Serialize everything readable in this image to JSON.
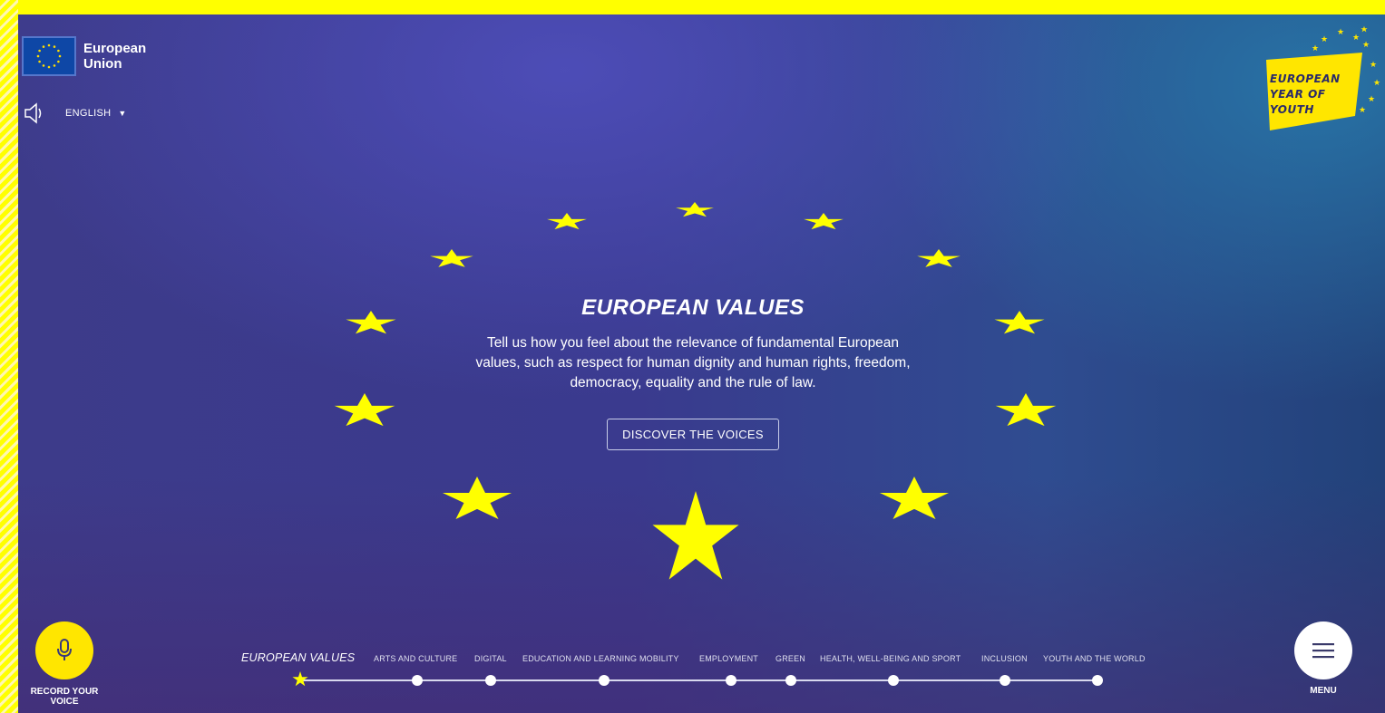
{
  "eu_logo": {
    "line1": "European",
    "line2": "Union"
  },
  "language": {
    "selected": "ENGLISH"
  },
  "eyoy_badge": {
    "line1": "EUROPEAN",
    "line2": "YEAR OF",
    "line3": "YOUTH"
  },
  "hero": {
    "title": "EUROPEAN VALUES",
    "description": "Tell us how you feel about the relevance of fundamental European values, such as respect for human dignity and human rights, freedom, democracy, equality and the rule of law.",
    "button_label": "DISCOVER THE VOICES"
  },
  "record": {
    "label_line1": "RECORD YOUR",
    "label_line2": "VOICE"
  },
  "menu": {
    "label": "MENU"
  },
  "timeline": {
    "items": [
      {
        "label": "EUROPEAN VALUES",
        "active": true
      },
      {
        "label": "ARTS AND CULTURE",
        "active": false
      },
      {
        "label": "DIGITAL",
        "active": false
      },
      {
        "label": "EDUCATION AND LEARNING MOBILITY",
        "active": false
      },
      {
        "label": "EMPLOYMENT",
        "active": false
      },
      {
        "label": "GREEN",
        "active": false
      },
      {
        "label": "HEALTH, WELL-BEING AND SPORT",
        "active": false
      },
      {
        "label": "INCLUSION",
        "active": false
      },
      {
        "label": "YOUTH AND THE WORLD",
        "active": false
      }
    ]
  },
  "colors": {
    "accent_yellow": "#ffff00",
    "button_yellow": "#ffe600",
    "background_blue": "#3d3b8a"
  },
  "icons": {
    "speaker": "speaker-icon",
    "mic": "microphone-icon",
    "menu": "hamburger-icon",
    "star": "star-icon"
  }
}
